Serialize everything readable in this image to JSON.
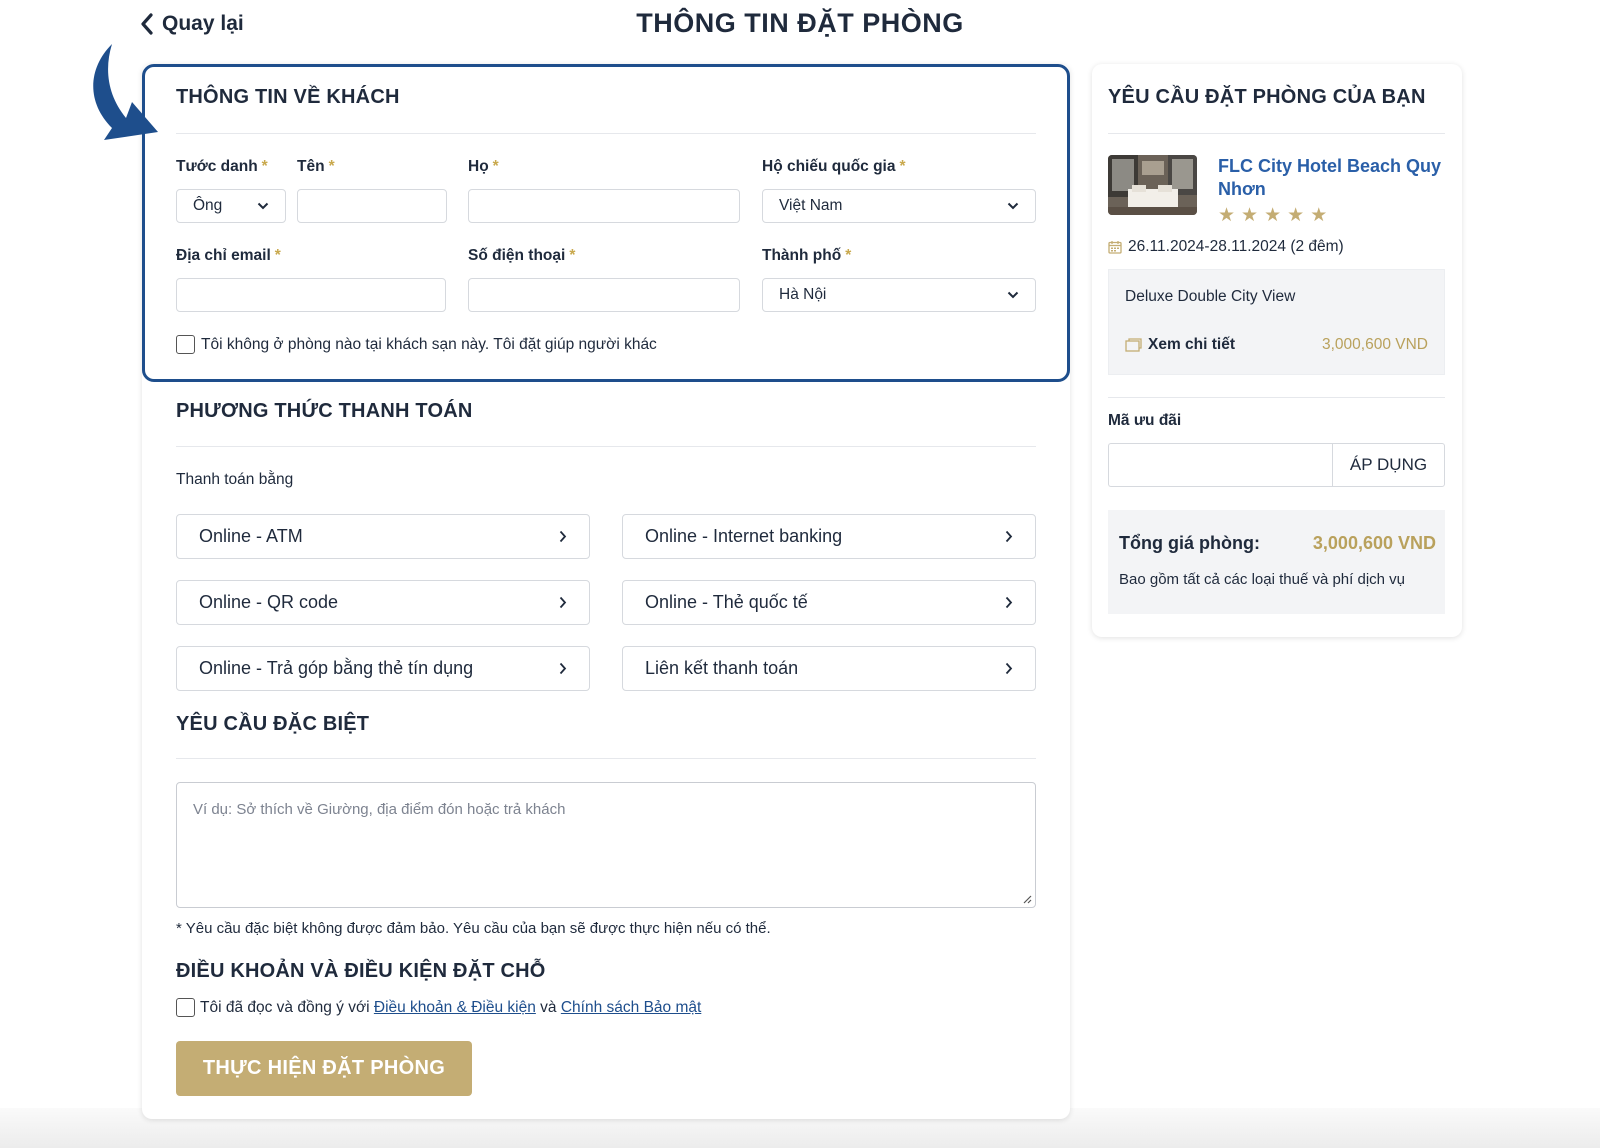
{
  "header": {
    "back_label": "Quay lại",
    "title": "THÔNG TIN ĐẶT PHÒNG"
  },
  "guest": {
    "section_title": "THÔNG TIN VỀ KHÁCH",
    "salutation_label": "Tước danh",
    "salutation_value": "Ông",
    "first_name_label": "Tên",
    "first_name_value": "",
    "last_name_label": "Họ",
    "last_name_value": "",
    "passport_label": "Hộ chiếu quốc gia",
    "passport_value": "Việt Nam",
    "email_label": "Địa chỉ email",
    "email_value": "",
    "phone_label": "Số điện thoại",
    "phone_value": "",
    "city_label": "Thành phố",
    "city_value": "Hà Nội",
    "required_mark": "*",
    "other_guest_label": "Tôi không ở phòng nào tại khách sạn này. Tôi đặt giúp người khác"
  },
  "payment": {
    "section_title": "PHƯƠNG THỨC THANH TOÁN",
    "subtitle": "Thanh toán bằng",
    "methods": [
      "Online - ATM",
      "Online - Internet banking",
      "Online - QR code",
      "Online - Thẻ quốc tế",
      "Online - Trả góp bằng thẻ tín dụng",
      "Liên kết thanh toán"
    ]
  },
  "special": {
    "section_title": "YÊU CẦU ĐẶC BIỆT",
    "placeholder": "Ví dụ: Sở thích về Giường, địa điểm đón hoặc trả khách",
    "note": "* Yêu cầu đặc biệt không được đảm bảo. Yêu cầu của bạn sẽ được thực hiện nếu có thể."
  },
  "terms": {
    "section_title": "ĐIỀU KHOẢN VÀ ĐIỀU KIỆN ĐẶT CHỖ",
    "agree_prefix": "Tôi đã đọc và đồng ý với ",
    "terms_link": "Điều khoản & Điều kiện",
    "and_text": " và ",
    "privacy_link": "Chính sách Bảo mật"
  },
  "submit_label": "THỰC HIỆN ĐẶT PHÒNG",
  "summary": {
    "section_title": "YÊU CẦU ĐẶT PHÒNG CỦA BẠN",
    "hotel_name": "FLC City Hotel Beach Quy Nhơn",
    "star_rating": 5,
    "dates": "26.11.2024-28.11.2024 (2 đêm)",
    "room_name": "Deluxe Double City View",
    "detail_label": "Xem chi tiết",
    "room_price": "3,000,600 VND",
    "promo_label": "Mã ưu đãi",
    "promo_value": "",
    "apply_label": "ÁP DỤNG",
    "total_label": "Tổng giá phòng:",
    "total_value": "3,000,600 VND",
    "total_note": "Bao gồm tất cả các loại thuế và phí dịch vụ"
  },
  "colors": {
    "brand_blue": "#1e4e8c",
    "gold": "#c4ad74",
    "text": "#1f2a3c"
  }
}
